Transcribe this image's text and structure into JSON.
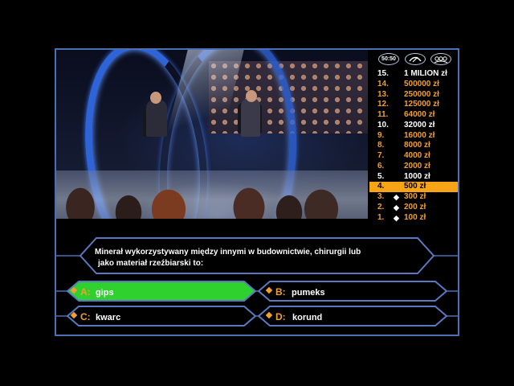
{
  "lifelines": [
    {
      "name": "fifty-fifty",
      "label": "50:50"
    },
    {
      "name": "phone-a-friend",
      "icon": "phone-icon"
    },
    {
      "name": "ask-the-audience",
      "icon": "audience-icon"
    }
  ],
  "ladder": [
    {
      "num": "15.",
      "amount": "1 MILION zł",
      "color": "white",
      "safe": false,
      "current": false
    },
    {
      "num": "14.",
      "amount": "500000 zł",
      "color": "orange",
      "safe": false,
      "current": false
    },
    {
      "num": "13.",
      "amount": "250000 zł",
      "color": "orange",
      "safe": false,
      "current": false
    },
    {
      "num": "12.",
      "amount": "125000 zł",
      "color": "orange",
      "safe": false,
      "current": false
    },
    {
      "num": "11.",
      "amount": "64000 zł",
      "color": "orange",
      "safe": false,
      "current": false
    },
    {
      "num": "10.",
      "amount": "32000 zł",
      "color": "white",
      "safe": false,
      "current": false
    },
    {
      "num": "9.",
      "amount": "16000 zł",
      "color": "orange",
      "safe": false,
      "current": false
    },
    {
      "num": "8.",
      "amount": "8000 zł",
      "color": "orange",
      "safe": false,
      "current": false
    },
    {
      "num": "7.",
      "amount": "4000 zł",
      "color": "orange",
      "safe": false,
      "current": false
    },
    {
      "num": "6.",
      "amount": "2000 zł",
      "color": "orange",
      "safe": false,
      "current": false
    },
    {
      "num": "5.",
      "amount": "1000 zł",
      "color": "white",
      "safe": false,
      "current": false
    },
    {
      "num": "4.",
      "amount": "500 zł",
      "color": "orange",
      "safe": false,
      "current": true
    },
    {
      "num": "3.",
      "amount": "300 zł",
      "color": "orange",
      "safe": true,
      "current": false
    },
    {
      "num": "2.",
      "amount": "200 zł",
      "color": "orange",
      "safe": true,
      "current": false
    },
    {
      "num": "1.",
      "amount": "100 zł",
      "color": "orange",
      "safe": true,
      "current": false
    }
  ],
  "question": {
    "line1": "Minerał wykorzystywany między innymi w budownictwie, chirurgii lub",
    "line2": "jako materiał rzeźbiarski to:"
  },
  "answers": [
    {
      "letter": "A:",
      "text": "gips",
      "selected": true
    },
    {
      "letter": "B:",
      "text": "pumeks",
      "selected": false
    },
    {
      "letter": "C:",
      "text": "kwarc",
      "selected": false
    },
    {
      "letter": "D:",
      "text": "korund",
      "selected": false
    }
  ],
  "colors": {
    "frame_blue": "#4d6fb3",
    "highlight_orange": "#f7a416",
    "selected_green": "#2fd12f",
    "prize_orange": "#f0a030"
  }
}
